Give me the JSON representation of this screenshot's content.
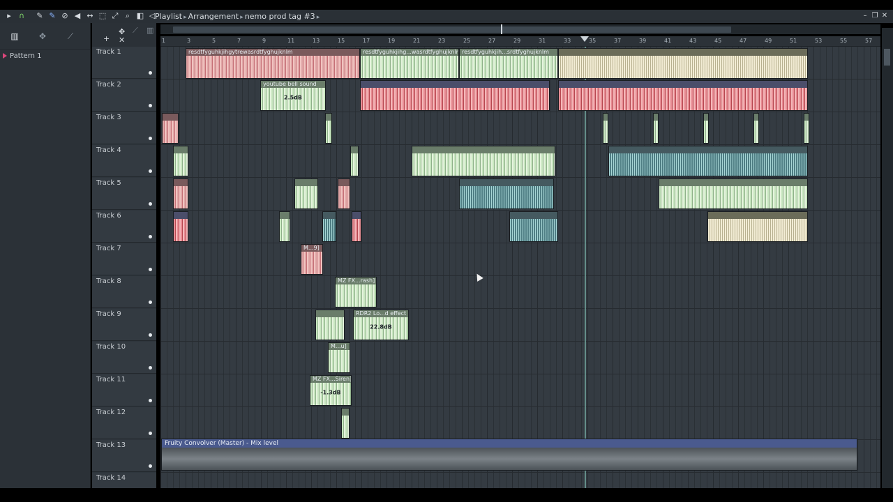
{
  "window": {
    "title_parts": [
      "Playlist",
      "Arrangement",
      "nemo prod tag #3"
    ]
  },
  "toolbar_icons": [
    "play-small-icon",
    "magnet-icon",
    "pencil-icon",
    "paint-icon",
    "delete-icon",
    "mute-icon",
    "slip-icon",
    "select-icon",
    "zoom-in-icon",
    "zoom-icon",
    "playback-icon",
    "speaker-icon"
  ],
  "left_panel": {
    "patterns": [
      {
        "label": "Pattern 1"
      }
    ]
  },
  "ruler": {
    "ticks": [
      "1",
      "3",
      "5",
      "7",
      "9",
      "11",
      "13",
      "15",
      "17",
      "19",
      "21",
      "23",
      "25",
      "27",
      "29",
      "31",
      "33",
      "35",
      "37",
      "39",
      "41",
      "43",
      "45",
      "47",
      "49",
      "51",
      "53",
      "55",
      "57"
    ]
  },
  "tracks": [
    {
      "name": "Track 1"
    },
    {
      "name": "Track 2"
    },
    {
      "name": "Track 3"
    },
    {
      "name": "Track 4"
    },
    {
      "name": "Track 5"
    },
    {
      "name": "Track 6"
    },
    {
      "name": "Track 7"
    },
    {
      "name": "Track 8"
    },
    {
      "name": "Track 9"
    },
    {
      "name": "Track 10"
    },
    {
      "name": "Track 11"
    },
    {
      "name": "Track 12"
    },
    {
      "name": "Track 13"
    },
    {
      "name": "Track 14"
    }
  ],
  "clips": {
    "t1a": "resdtfyguhkjihgytrewasrdtfyghujknlm",
    "t1b": "resdtfyguhkjihg...wasrdtfyghujknlm",
    "t1c": "resdtfyguhkjih...srdtfyghujknlm",
    "t2a": "youtube bell sound",
    "t2a_gain": "2.5dB",
    "t7": "M...9]",
    "t8": "MZ FX...rash]",
    "t9": "RDR2 Lo...d effect",
    "t9_gain": "22.8dB",
    "t10": "M...u]",
    "t11": "MZ FX...Siren]",
    "t11_gain": "-1.3dB",
    "automation": "Fruity Convolver (Master) - Mix level"
  }
}
